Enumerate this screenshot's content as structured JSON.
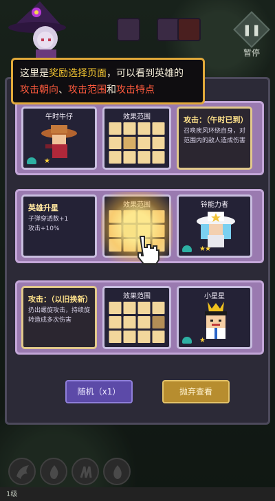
{
  "hud": {
    "pause_label": "暂停",
    "level_label": "1级"
  },
  "tutorial": {
    "seg1": "这里是",
    "seg2": "奖励选择页面",
    "seg3": "，可以看到英雄的",
    "seg4": "攻击朝向",
    "seg5": "、",
    "seg6": "攻击范围",
    "seg7": "和",
    "seg8": "攻击特点"
  },
  "rows": [
    {
      "hero_name": "午时牛仔",
      "grid_title": "效果范围",
      "desc_title": "攻击：（午时已到）",
      "desc_text": "召唤疾风环绕自身，对范围内的敌人造成伤害",
      "stars": "★"
    },
    {
      "desc_title": "英雄升星",
      "desc_text": "子弹穿透数+1\n攻击+10%",
      "grid_title": "效果范围",
      "hero_name": "铃能力者",
      "stars": "★★"
    },
    {
      "desc_title": "攻击：（以旧换新）",
      "desc_text": "扔出螺旋攻击，持续旋转造成多次伤害",
      "grid_title": "效果范围",
      "hero_name": "小星星",
      "stars": "★"
    }
  ],
  "buttons": {
    "random": "随机（x1）",
    "abandon": "抛弃查看"
  },
  "colors": {
    "accent_gold": "#e1a93a",
    "highlight_yellow": "#f3c531",
    "highlight_red": "#ff5a3d",
    "random_button": "#5c4aa8"
  }
}
